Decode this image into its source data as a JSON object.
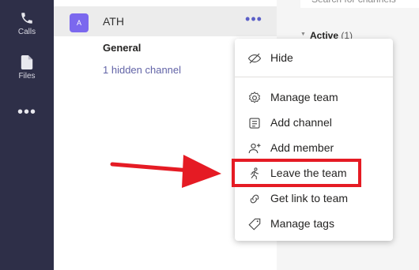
{
  "rail": {
    "calls_label": "Calls",
    "files_label": "Files",
    "more_label": "•••"
  },
  "team": {
    "avatar_letter": "A",
    "name": "ATH",
    "more_label": "•••",
    "channel": "General",
    "hidden_channels": "1 hidden channel"
  },
  "right": {
    "search_placeholder": "Search for channels",
    "active_label": "Active",
    "active_count": "(1)"
  },
  "menu": {
    "items": [
      {
        "label": "Hide",
        "icon": "eye-slash-icon"
      },
      {
        "label": "Manage team",
        "icon": "gear-icon"
      },
      {
        "label": "Add channel",
        "icon": "channel-icon"
      },
      {
        "label": "Add member",
        "icon": "add-person-icon"
      },
      {
        "label": "Leave the team",
        "icon": "leave-icon"
      },
      {
        "label": "Get link to team",
        "icon": "link-icon"
      },
      {
        "label": "Manage tags",
        "icon": "tag-icon"
      }
    ]
  },
  "colors": {
    "accent": "#6264a7",
    "rail": "#2e2f48",
    "highlight": "#e51b24"
  }
}
